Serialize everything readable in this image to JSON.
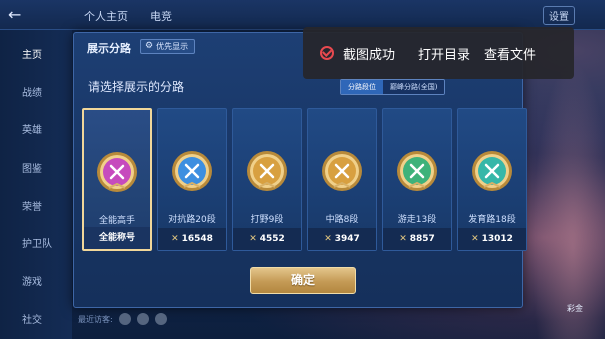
{
  "app": {
    "back_glyph": "←",
    "top_tabs": [
      "个人主页",
      "电竞"
    ],
    "top_right_label": "设置"
  },
  "sidebar": {
    "items": [
      {
        "label": "主页",
        "active": true
      },
      {
        "label": "战绩",
        "active": false
      },
      {
        "label": "英雄",
        "active": false
      },
      {
        "label": "图鉴",
        "active": false
      },
      {
        "label": "荣誉",
        "active": false
      },
      {
        "label": "护卫队",
        "active": false
      },
      {
        "label": "游戏",
        "active": false
      },
      {
        "label": "社交",
        "active": false
      }
    ]
  },
  "dialog": {
    "title": "展示分路",
    "priority_label": "优先显示",
    "prompt": "请选择展示的分路",
    "segments": [
      {
        "label": "分路段位",
        "active": true
      },
      {
        "label": "巅峰分路(全国)",
        "active": false
      }
    ],
    "cards": [
      {
        "name": "全能高手",
        "footer": "全能称号",
        "selected": true,
        "icon": "all-round-badge-icon",
        "color": "#c64bbd"
      },
      {
        "name": "对抗路20段",
        "footer": "16548",
        "selected": false,
        "icon": "clash-lane-badge-icon",
        "color": "#3d8fe0"
      },
      {
        "name": "打野9段",
        "footer": "4552",
        "selected": false,
        "icon": "jungle-badge-icon",
        "color": "#d8a040"
      },
      {
        "name": "中路8段",
        "footer": "3947",
        "selected": false,
        "icon": "mid-lane-badge-icon",
        "color": "#d8a040"
      },
      {
        "name": "游走13段",
        "footer": "8857",
        "selected": false,
        "icon": "roam-badge-icon",
        "color": "#3fb27a"
      },
      {
        "name": "发育路18段",
        "footer": "13012",
        "selected": false,
        "icon": "farm-lane-badge-icon",
        "color": "#37b7a8"
      }
    ],
    "confirm_label": "确定"
  },
  "bottom": {
    "label": "最近访客:"
  },
  "toast": {
    "message": "截图成功",
    "open_dir": "打开目录",
    "view_file": "查看文件"
  },
  "fab_label": "彩金"
}
